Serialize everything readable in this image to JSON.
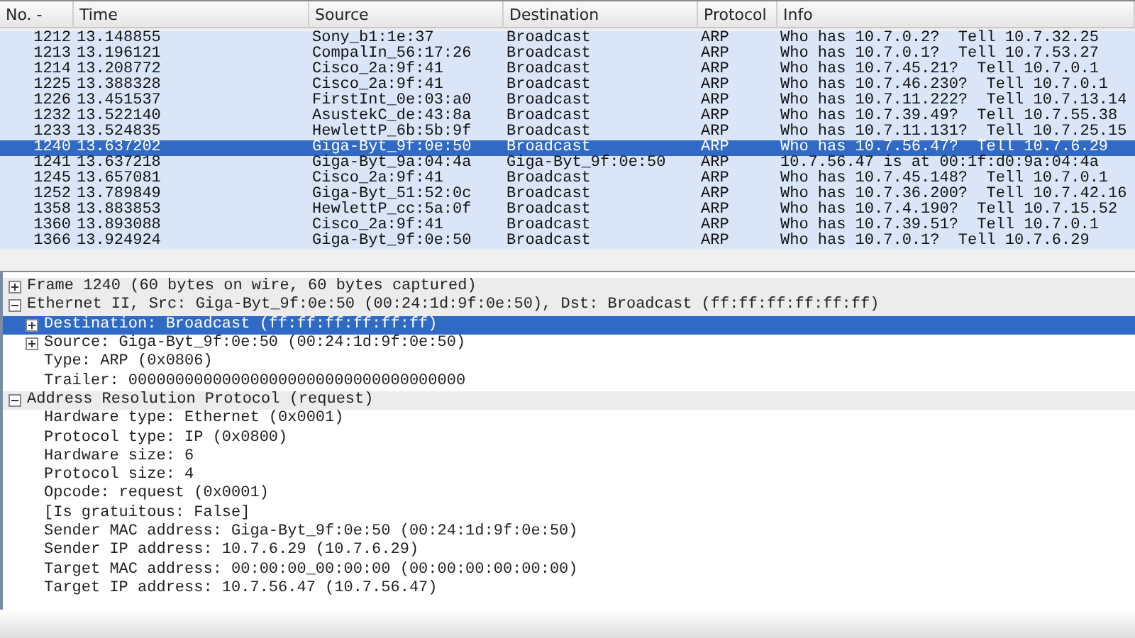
{
  "packet_list": {
    "columns": [
      "No. -",
      "Time",
      "Source",
      "Destination",
      "Protocol",
      "Info"
    ],
    "rows": [
      {
        "cells": [
          "1212",
          "13.148855",
          "Sony_b1:1e:37",
          "Broadcast",
          "ARP",
          "Who has 10.7.0.2?  Tell 10.7.32.25"
        ],
        "selected": false
      },
      {
        "cells": [
          "1213",
          "13.196121",
          "CompalIn_56:17:26",
          "Broadcast",
          "ARP",
          "Who has 10.7.0.1?  Tell 10.7.53.27"
        ],
        "selected": false
      },
      {
        "cells": [
          "1214",
          "13.208772",
          "Cisco_2a:9f:41",
          "Broadcast",
          "ARP",
          "Who has 10.7.45.21?  Tell 10.7.0.1"
        ],
        "selected": false
      },
      {
        "cells": [
          "1225",
          "13.388328",
          "Cisco_2a:9f:41",
          "Broadcast",
          "ARP",
          "Who has 10.7.46.230?  Tell 10.7.0.1"
        ],
        "selected": false
      },
      {
        "cells": [
          "1226",
          "13.451537",
          "FirstInt_0e:03:a0",
          "Broadcast",
          "ARP",
          "Who has 10.7.11.222?  Tell 10.7.13.14"
        ],
        "selected": false
      },
      {
        "cells": [
          "1232",
          "13.522140",
          "AsustekC_de:43:8a",
          "Broadcast",
          "ARP",
          "Who has 10.7.39.49?  Tell 10.7.55.38"
        ],
        "selected": false
      },
      {
        "cells": [
          "1233",
          "13.524835",
          "HewlettP_6b:5b:9f",
          "Broadcast",
          "ARP",
          "Who has 10.7.11.131?  Tell 10.7.25.15"
        ],
        "selected": false
      },
      {
        "cells": [
          "1240",
          "13.637202",
          "Giga-Byt_9f:0e:50",
          "Broadcast",
          "ARP",
          "Who has 10.7.56.47?  Tell 10.7.6.29"
        ],
        "selected": true
      },
      {
        "cells": [
          "1241",
          "13.637218",
          "Giga-Byt_9a:04:4a",
          "Giga-Byt_9f:0e:50",
          "ARP",
          "10.7.56.47 is at 00:1f:d0:9a:04:4a"
        ],
        "selected": false
      },
      {
        "cells": [
          "1245",
          "13.657081",
          "Cisco_2a:9f:41",
          "Broadcast",
          "ARP",
          "Who has 10.7.45.148?  Tell 10.7.0.1"
        ],
        "selected": false
      },
      {
        "cells": [
          "1252",
          "13.789849",
          "Giga-Byt_51:52:0c",
          "Broadcast",
          "ARP",
          "Who has 10.7.36.200?  Tell 10.7.42.16"
        ],
        "selected": false
      },
      {
        "cells": [
          "1358",
          "13.883853",
          "HewlettP_cc:5a:0f",
          "Broadcast",
          "ARP",
          "Who has 10.7.4.190?  Tell 10.7.15.52"
        ],
        "selected": false
      },
      {
        "cells": [
          "1360",
          "13.893088",
          "Cisco_2a:9f:41",
          "Broadcast",
          "ARP",
          "Who has 10.7.39.51?  Tell 10.7.0.1"
        ],
        "selected": false
      },
      {
        "cells": [
          "1366",
          "13.924924",
          "Giga-Byt_9f:0e:50",
          "Broadcast",
          "ARP",
          "Who has 10.7.0.1?  Tell 10.7.6.29"
        ],
        "selected": false
      }
    ]
  },
  "details": [
    {
      "text": "Frame 1240 (60 bytes on wire, 60 bytes captured)",
      "expanded": false,
      "selected": false
    },
    {
      "text": "Ethernet II, Src: Giga-Byt_9f:0e:50 (00:24:1d:9f:0e:50), Dst: Broadcast (ff:ff:ff:ff:ff:ff)",
      "expanded": true,
      "selected": false,
      "children": [
        {
          "text": "Destination: Broadcast (ff:ff:ff:ff:ff:ff)",
          "expanded": false,
          "selected": true
        },
        {
          "text": "Source: Giga-Byt_9f:0e:50 (00:24:1d:9f:0e:50)",
          "expanded": false,
          "selected": false
        },
        {
          "text": "Type: ARP (0x0806)",
          "selected": false
        },
        {
          "text": "Trailer: 000000000000000000000000000000000000",
          "selected": false
        }
      ]
    },
    {
      "text": "Address Resolution Protocol (request)",
      "expanded": true,
      "selected": false,
      "children": [
        {
          "text": "Hardware type: Ethernet (0x0001)",
          "selected": false
        },
        {
          "text": "Protocol type: IP (0x0800)",
          "selected": false
        },
        {
          "text": "Hardware size: 6",
          "selected": false
        },
        {
          "text": "Protocol size: 4",
          "selected": false
        },
        {
          "text": "Opcode: request (0x0001)",
          "selected": false
        },
        {
          "text": "[Is gratuitous: False]",
          "selected": false
        },
        {
          "text": "Sender MAC address: Giga-Byt_9f:0e:50 (00:24:1d:9f:0e:50)",
          "selected": false
        },
        {
          "text": "Sender IP address: 10.7.6.29 (10.7.6.29)",
          "selected": false
        },
        {
          "text": "Target MAC address: 00:00:00_00:00:00 (00:00:00:00:00:00)",
          "selected": false
        },
        {
          "text": "Target IP address: 10.7.56.47 (10.7.56.47)",
          "selected": false
        }
      ]
    }
  ]
}
